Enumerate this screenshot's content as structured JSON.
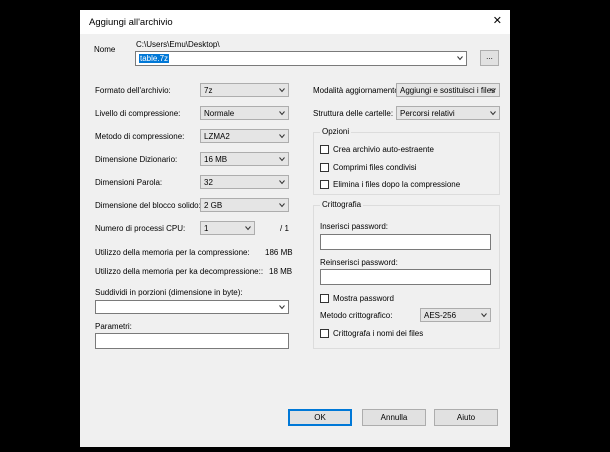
{
  "window": {
    "title": "Aggiungi all'archivio"
  },
  "name": {
    "label": "Nome",
    "path": "C:\\Users\\Emu\\Desktop\\",
    "value": "table.7z",
    "browse": "..."
  },
  "left": {
    "format": {
      "label": "Formato dell'archivio:",
      "value": "7z"
    },
    "level": {
      "label": "Livello di compressione:",
      "value": "Normale"
    },
    "method": {
      "label": "Metodo di compressione:",
      "value": "LZMA2"
    },
    "dict": {
      "label": "Dimensione Dizionario:",
      "value": "16 MB"
    },
    "word": {
      "label": "Dimensioni Parola:",
      "value": "32"
    },
    "solid": {
      "label": "Dimensione del blocco solido:",
      "value": "2 GB"
    },
    "threads": {
      "label": "Numero di processi CPU:",
      "value": "1",
      "total": "/ 1"
    },
    "mem_comp": {
      "label": "Utilizzo della memoria per la compressione:",
      "value": "186 MB"
    },
    "mem_decomp": {
      "label": "Utilizzo della memoria per ka decompressione::",
      "value": "18 MB"
    },
    "split": {
      "label": "Suddividi in porzioni (dimensione in byte):",
      "value": ""
    },
    "params": {
      "label": "Parametri:",
      "value": ""
    }
  },
  "right": {
    "update": {
      "label": "Modalità aggiornamento:",
      "value": "Aggiungi e sostituisci i files"
    },
    "paths": {
      "label": "Struttura delle cartelle:",
      "value": "Percorsi relativi"
    },
    "options": {
      "title": "Opzioni",
      "sfx": "Crea archivio auto-estraente",
      "shared": "Comprimi files condivisi",
      "delete": "Elimina i files dopo la compressione"
    },
    "encryption": {
      "title": "Crittografia",
      "pw_label": "Inserisci password:",
      "pw2_label": "Reinserisci password:",
      "show": "Mostra password",
      "method_label": "Metodo crittografico:",
      "method_value": "AES-256",
      "names": "Crittografa i nomi dei files"
    }
  },
  "buttons": {
    "ok": "OK",
    "cancel": "Annulla",
    "help": "Aiuto"
  }
}
